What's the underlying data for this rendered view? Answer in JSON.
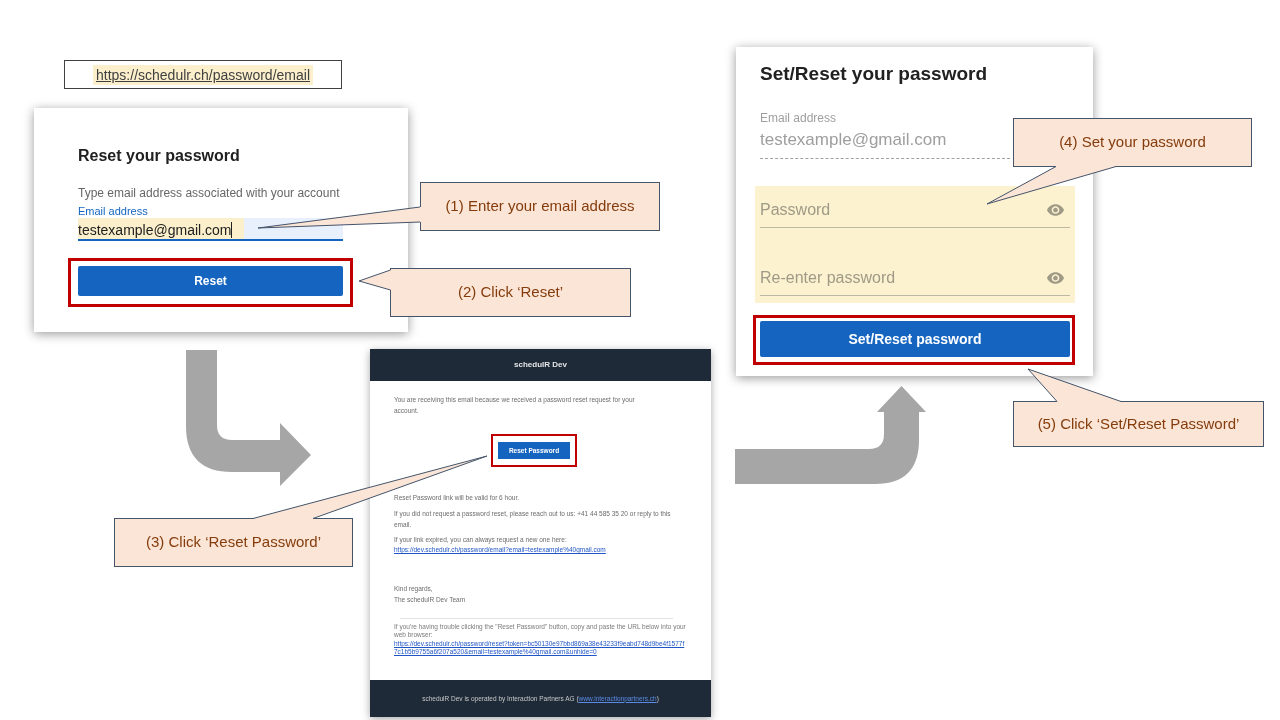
{
  "url_bar": {
    "text": "https://schedulr.ch/password/email",
    "highlighted": true
  },
  "reset_request_form": {
    "title": "Reset your password",
    "description": "Type email address associated with your account",
    "email_field": {
      "label": "Email address",
      "value": "testexample@gmail.com",
      "focused": true,
      "highlighted": true
    },
    "button": {
      "label": "Reset",
      "framed": true
    }
  },
  "email_preview": {
    "header": "schedulR Dev",
    "intro": "You are receiving this email because we received a password reset request for your account.",
    "button": {
      "label": "Reset Password",
      "framed": true
    },
    "validity_note": "Reset Password link will be valid for 6 hour.",
    "contact_note": "If you did not request a password reset, please reach out to us: +41 44 585 35 20 or reply to this email.",
    "expired_note": {
      "text": "If your link expired, you can always request a new one here:",
      "link": "https://dev.schedulr.ch/password/email?email=testexample%40gmail.com"
    },
    "closing": [
      "Kind regards,",
      "The schedulR Dev Team"
    ],
    "fallback_note": "If you're having trouble clicking the \"Reset Password\" button, copy and paste the URL below into your web browser:",
    "fallback_link": "https://dev.schedulr.ch/password/reset?token=bc50130e97bbd869a38e43233f9eabd748d9be4f1577f7c1b5b9755a6f207a520&email=testexample%40gmail.com&unhide=0",
    "footer": {
      "text": "schedulR Dev is operated by Interaction Partners AG (",
      "link": "www.interactionpartners.ch",
      "suffix": ")"
    }
  },
  "set_password_form": {
    "title": "Set/Reset your password",
    "email_field": {
      "label": "Email address",
      "value": "testexample@gmail.com"
    },
    "password_fields": {
      "highlighted": true,
      "fields": [
        {
          "placeholder": "Password"
        },
        {
          "placeholder": "Re-enter password"
        }
      ]
    },
    "button": {
      "label": "Set/Reset password",
      "framed": true
    }
  },
  "callouts": [
    {
      "text": "(1) Enter your email address"
    },
    {
      "text": "(2) Click ‘Reset’"
    },
    {
      "text": "(3) Click ‘Reset Password’"
    },
    {
      "text": "(4) Set your password"
    },
    {
      "text": "(5) Click ‘Set/Reset Password’"
    }
  ]
}
